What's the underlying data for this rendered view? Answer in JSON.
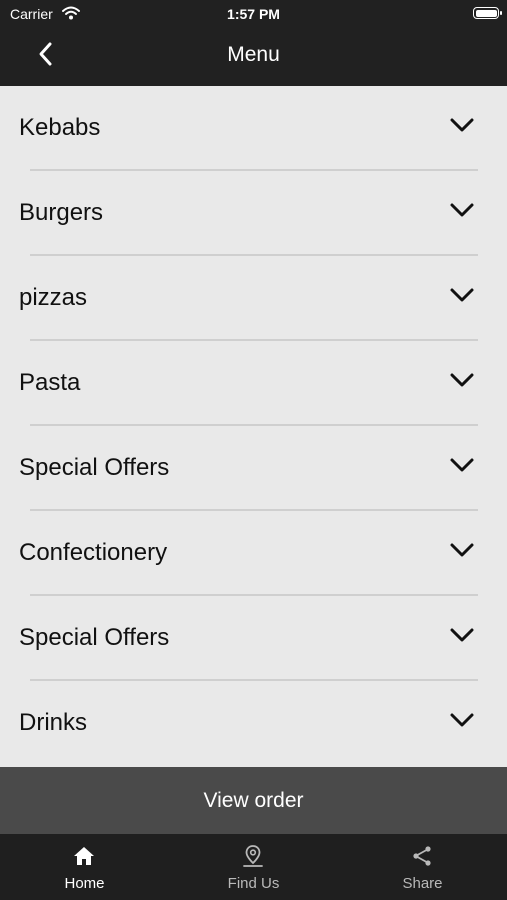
{
  "status_bar": {
    "carrier": "Carrier",
    "time": "1:57 PM"
  },
  "nav": {
    "title": "Menu",
    "back_icon": "chevron-left-icon"
  },
  "menu": {
    "items": [
      {
        "label": "Kebabs"
      },
      {
        "label": "Burgers"
      },
      {
        "label": "pizzas"
      },
      {
        "label": "Pasta"
      },
      {
        "label": "Special Offers"
      },
      {
        "label": "Confectionery"
      },
      {
        "label": "Special Offers"
      },
      {
        "label": "Drinks"
      }
    ],
    "expand_icon": "chevron-down-icon"
  },
  "order": {
    "button_label": "View order"
  },
  "tabs": [
    {
      "label": "Home",
      "icon": "home-icon",
      "active": true
    },
    {
      "label": "Find Us",
      "icon": "location-pin-icon",
      "active": false
    },
    {
      "label": "Share",
      "icon": "share-icon",
      "active": false
    }
  ],
  "colors": {
    "bar": "#212121",
    "list_bg": "#e9e9e9",
    "order_bar": "#4a4a4a",
    "active_tab": "#ffffff",
    "inactive_tab": "#b9b9b9"
  }
}
